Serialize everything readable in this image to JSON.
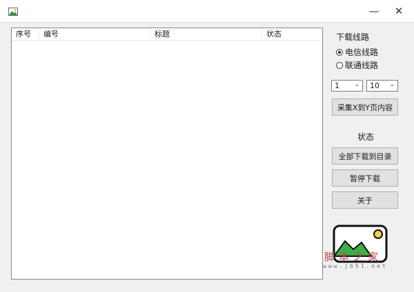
{
  "listview": {
    "columns": [
      "序号",
      "编号",
      "标题",
      "状态"
    ]
  },
  "sidebar": {
    "download_line_label": "下载线路",
    "radio_options": [
      {
        "label": "电信线路",
        "checked": true
      },
      {
        "label": "联通线路",
        "checked": false
      }
    ],
    "page_from": "1",
    "page_to": "10",
    "collect_button": "采集X到Y页内容",
    "status_label": "状态",
    "download_all_button": "全部下载到目录",
    "pause_button": "暂停下载",
    "about_button": "关于"
  },
  "watermark": {
    "brand": "脚本之家",
    "url": "www.jb51.net"
  },
  "icons": {
    "app": "app-icon",
    "minimize": "minimize-icon",
    "close": "close-icon"
  }
}
